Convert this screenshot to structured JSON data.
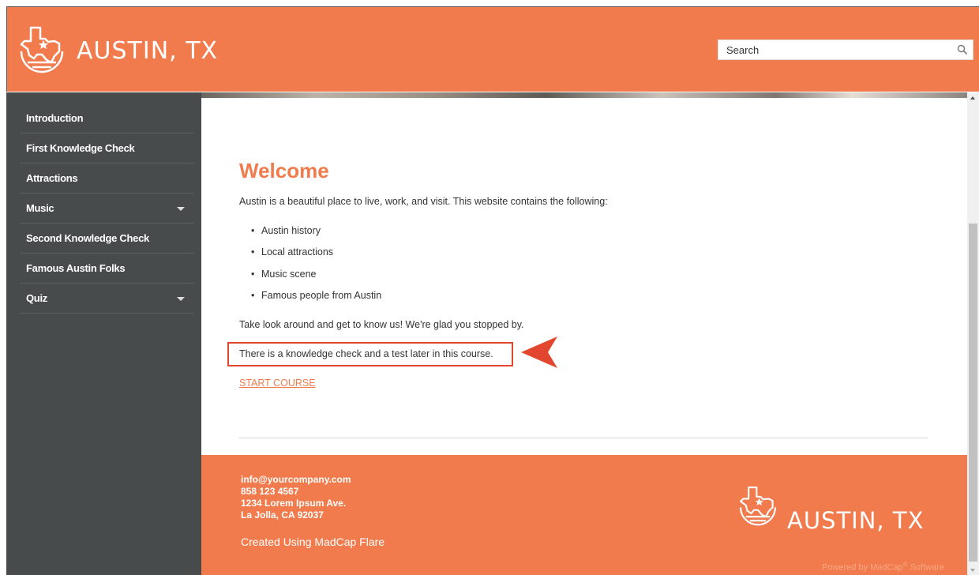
{
  "header": {
    "brand": "AUSTIN, TX",
    "search_placeholder": "Search"
  },
  "sidebar": {
    "items": [
      {
        "label": "Introduction",
        "has_submenu": false
      },
      {
        "label": "First Knowledge Check",
        "has_submenu": false
      },
      {
        "label": "Attractions",
        "has_submenu": false
      },
      {
        "label": "Music",
        "has_submenu": true
      },
      {
        "label": "Second Knowledge Check",
        "has_submenu": false
      },
      {
        "label": "Famous Austin Folks",
        "has_submenu": false
      },
      {
        "label": "Quiz",
        "has_submenu": true
      }
    ]
  },
  "main": {
    "title": "Welcome",
    "intro": "Austin is a beautiful place to live, work, and visit. This website contains the following:",
    "bullets": [
      "Austin history",
      "Local attractions",
      "Music scene",
      "Famous people from Austin"
    ],
    "look_around": "Take look around and get to know us! We're glad you stopped by.",
    "highlighted_notice": "There is a knowledge check and a test later in this course.",
    "start_link": "START COURSE"
  },
  "footer": {
    "email": "info@yourcompany.com",
    "phone": "858 123 4567",
    "address1": "1234 Lorem Ipsum Ave.",
    "address2": "La Jolla, CA 92037",
    "created_with": "Created Using MadCap Flare",
    "brand": "AUSTIN, TX",
    "powered_prefix": "Powered by MadCap",
    "powered_mark": "®",
    "powered_suffix": " Software"
  },
  "colors": {
    "accent": "#f17b4c",
    "sidebar": "#484b4c",
    "callout": "#e3462e"
  }
}
